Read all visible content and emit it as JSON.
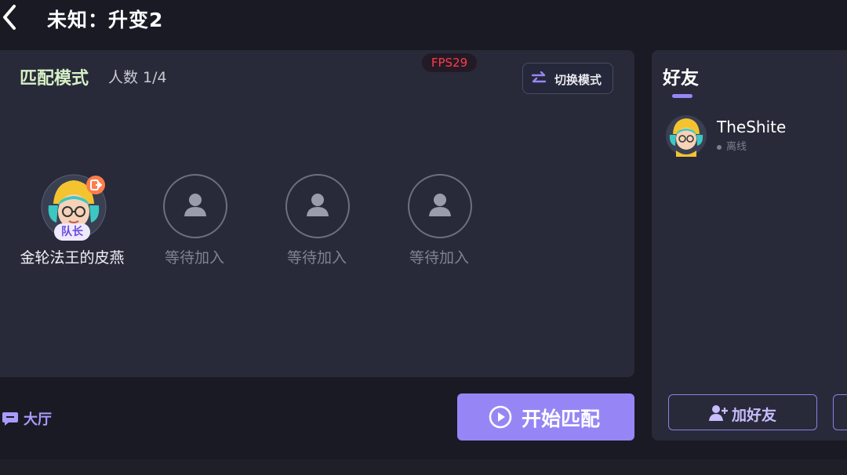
{
  "header": {
    "title": "未知：升变2"
  },
  "match_panel": {
    "mode_label": "匹配模式",
    "player_count": "人数 1/4",
    "fps": "FPS29",
    "switch_mode_label": "切换模式",
    "leader": {
      "name": "金轮法王的皮燕",
      "badge": "队长"
    },
    "empty_slots": [
      {
        "label": "等待加入"
      },
      {
        "label": "等待加入"
      },
      {
        "label": "等待加入"
      }
    ]
  },
  "footer": {
    "lobby_label": "大厅",
    "start_label": "开始匹配"
  },
  "friends": {
    "title": "好友",
    "list": [
      {
        "name": "TheShite",
        "status": "离线"
      }
    ],
    "add_friend_label": "加好友"
  },
  "colors": {
    "accent": "#9686f5",
    "panel": "#282a39",
    "background": "#1a1a24",
    "fps": "#ff3b4a"
  },
  "icons": [
    "back-arrow-icon",
    "switch-icon",
    "person-placeholder-icon",
    "exit-icon",
    "chat-icon",
    "play-icon",
    "add-user-icon"
  ]
}
